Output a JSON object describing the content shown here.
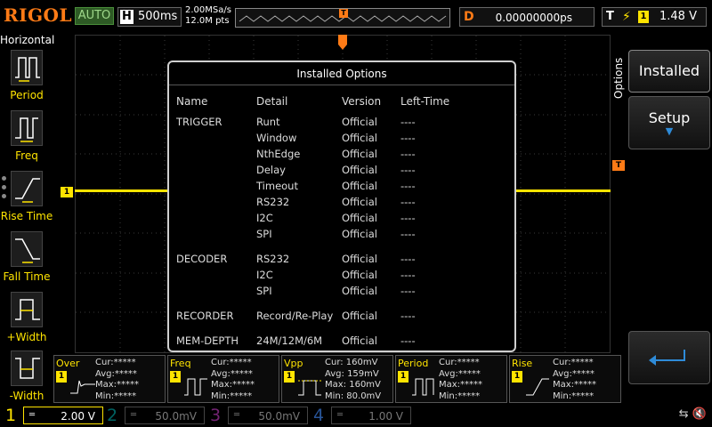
{
  "topbar": {
    "logo": "RIGOL",
    "run_mode": "AUTO",
    "timebase_badge": "H",
    "timebase_value": "500ms",
    "sample_rate": "2.00MSa/s",
    "memory_points": "12.0M pts",
    "trigger_marker": "T",
    "delay_badge": "D",
    "delay_value": "0.00000000ps",
    "trigger_badge": "T",
    "trigger_source": "1",
    "trigger_level": "1.48 V"
  },
  "left_panel": {
    "title": "Horizontal",
    "items": [
      {
        "label": "Period"
      },
      {
        "label": "Freq"
      },
      {
        "label": "Rise Time"
      },
      {
        "label": "Fall Time"
      },
      {
        "label": "+Width"
      },
      {
        "label": "-Width"
      }
    ]
  },
  "waveform": {
    "ch1_marker": "1",
    "trigger_top_marker": "T",
    "trigger_level_marker": "T"
  },
  "right_menu": {
    "title": "Options",
    "installed_label": "Installed",
    "setup_label": "Setup",
    "back_icon": "return-arrow-icon"
  },
  "dialog": {
    "title": "Installed Options",
    "headers": {
      "name": "Name",
      "detail": "Detail",
      "version": "Version",
      "left_time": "Left-Time"
    },
    "rows": [
      {
        "name": "TRIGGER",
        "detail": "Runt",
        "version": "Official",
        "left_time": "----"
      },
      {
        "name": "",
        "detail": "Window",
        "version": "Official",
        "left_time": "----"
      },
      {
        "name": "",
        "detail": "NthEdge",
        "version": "Official",
        "left_time": "----"
      },
      {
        "name": "",
        "detail": "Delay",
        "version": "Official",
        "left_time": "----"
      },
      {
        "name": "",
        "detail": "Timeout",
        "version": "Official",
        "left_time": "----"
      },
      {
        "name": "",
        "detail": "RS232",
        "version": "Official",
        "left_time": "----"
      },
      {
        "name": "",
        "detail": "I2C",
        "version": "Official",
        "left_time": "----"
      },
      {
        "name": "",
        "detail": "SPI",
        "version": "Official",
        "left_time": "----"
      },
      {
        "name": "DECODER",
        "detail": "RS232",
        "version": "Official",
        "left_time": "----"
      },
      {
        "name": "",
        "detail": "I2C",
        "version": "Official",
        "left_time": "----"
      },
      {
        "name": "",
        "detail": "SPI",
        "version": "Official",
        "left_time": "----"
      },
      {
        "name": "RECORDER",
        "detail": "Record/Re-Play",
        "version": "Official",
        "left_time": "----"
      },
      {
        "name": "MEM-DEPTH",
        "detail": "24M/12M/6M",
        "version": "Official",
        "left_time": "----"
      }
    ]
  },
  "measurements": [
    {
      "name": "Over",
      "ch": "1",
      "cur": "Cur:*****",
      "avg": "Avg:*****",
      "max": "Max:*****",
      "min": "Min:*****"
    },
    {
      "name": "Freq",
      "ch": "1",
      "cur": "Cur:*****",
      "avg": "Avg:*****",
      "max": "Max:*****",
      "min": "Min:*****"
    },
    {
      "name": "Vpp",
      "ch": "1",
      "cur": "Cur: 160mV",
      "avg": "Avg: 159mV",
      "max": "Max: 160mV",
      "min": "Min: 80.0mV"
    },
    {
      "name": "Period",
      "ch": "1",
      "cur": "Cur:*****",
      "avg": "Avg:*****",
      "max": "Max:*****",
      "min": "Min:*****"
    },
    {
      "name": "Rise",
      "ch": "1",
      "cur": "Cur:*****",
      "avg": "Avg:*****",
      "max": "Max:*****",
      "min": "Min:*****"
    }
  ],
  "channels": [
    {
      "num": "1",
      "value": "2.00 V",
      "color": "#ffe400"
    },
    {
      "num": "2",
      "value": "50.0mV",
      "color": "#00b4b4"
    },
    {
      "num": "3",
      "value": "50.0mV",
      "color": "#d040d0"
    },
    {
      "num": "4",
      "value": "1.00 V",
      "color": "#3a78d8"
    }
  ],
  "colors": {
    "ch1": "#ffe400",
    "trigger": "#ff7b16",
    "accent": "#2e8bd8"
  }
}
